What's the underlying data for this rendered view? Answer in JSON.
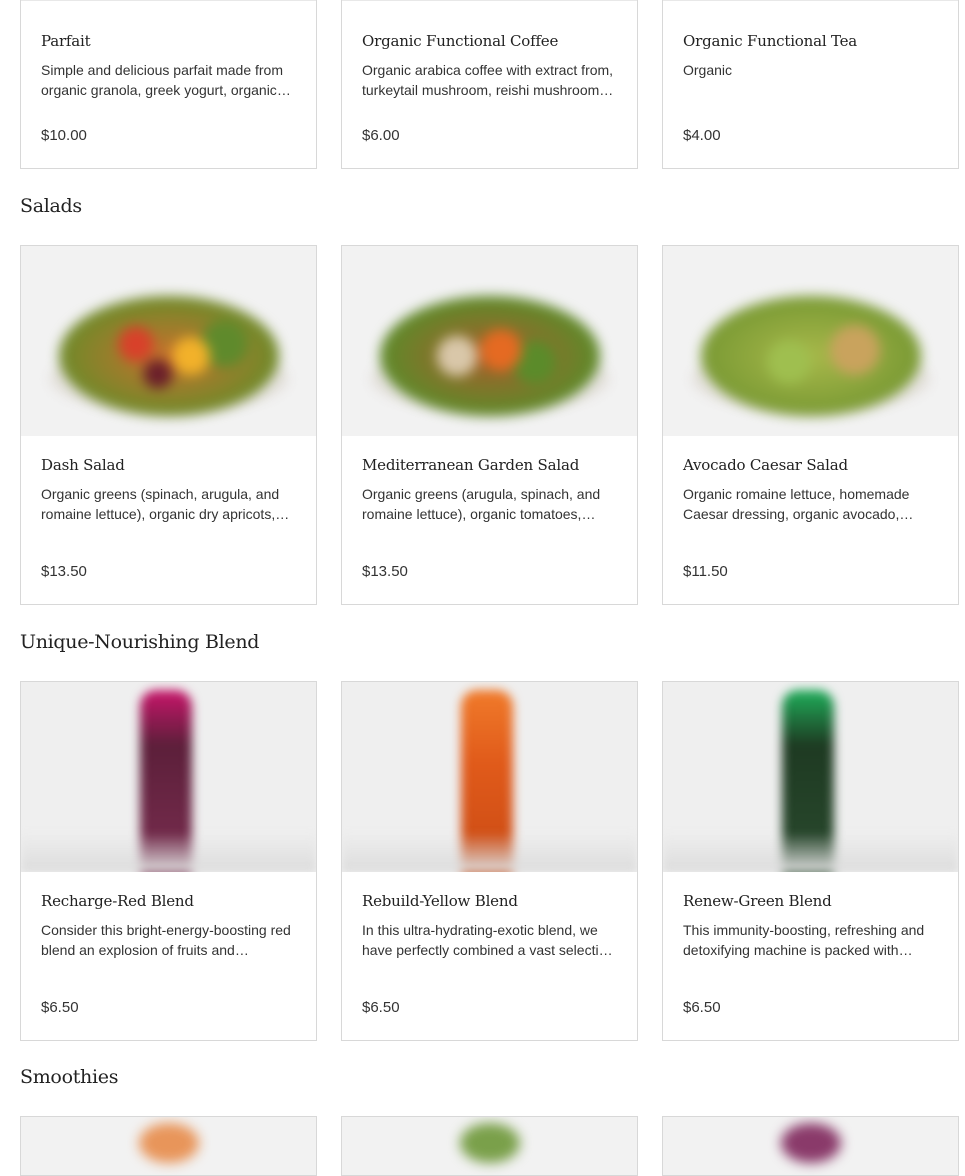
{
  "top_row": [
    {
      "title": "Parfait",
      "description": "Simple and delicious parfait made from organic granola, greek yogurt, organic fruits and honey.",
      "price": "$10.00"
    },
    {
      "title": "Organic Functional Coffee",
      "description": "Organic arabica coffee with extract from, turkeytail mushroom, reishi mushroom and more.",
      "price": "$6.00"
    },
    {
      "title": "Organic Functional Tea",
      "description": "Organic",
      "price": "$4.00"
    }
  ],
  "sections": [
    {
      "title": "Salads",
      "items": [
        {
          "title": "Dash Salad",
          "description": "Organic greens (spinach, arugula, and romaine lettuce), organic dry apricots, organic tomatoes and more.",
          "price": "$13.50",
          "image": "salad-bowl-image"
        },
        {
          "title": "Mediterranean Garden Salad",
          "description": "Organic greens (arugula, spinach, and romaine lettuce), organic tomatoes, organic carrots and more.",
          "price": "$13.50",
          "image": "salad-bowl-image"
        },
        {
          "title": "Avocado Caesar Salad",
          "description": "Organic romaine lettuce, homemade Caesar dressing, organic avocado, croutons and more.",
          "price": "$11.50",
          "image": "salad-bowl-image"
        }
      ]
    },
    {
      "title": "Unique-Nourishing Blend",
      "items": [
        {
          "title": "Recharge-Red Blend",
          "description": "Consider this bright-energy-boosting red blend an explosion of fruits and vegetables.",
          "price": "$6.50",
          "image": "juice-bottle-image"
        },
        {
          "title": "Rebuild-Yellow Blend",
          "description": "In this ultra-hydrating-exotic blend, we have perfectly combined a vast selection of fruits.",
          "price": "$6.50",
          "image": "juice-bottle-image"
        },
        {
          "title": "Renew-Green Blend",
          "description": "This immunity-boosting, refreshing and detoxifying machine is packed with greens.",
          "price": "$6.50",
          "image": "juice-bottle-image"
        }
      ]
    },
    {
      "title": "Smoothies",
      "items": []
    }
  ],
  "colors": {
    "card_border": "#d8d8d8",
    "text": "#222222"
  }
}
